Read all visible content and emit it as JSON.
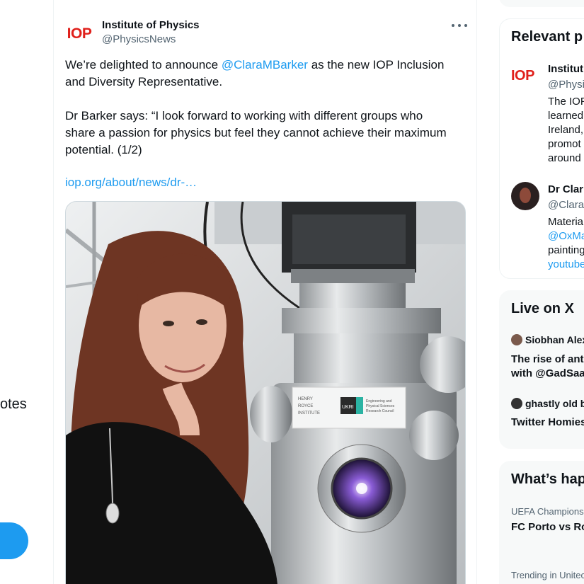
{
  "left_nav": {
    "notes_label": "otes"
  },
  "tweet": {
    "author_name": "Institute of Physics",
    "author_handle": "@PhysicsNews",
    "avatar_logo": "IOP",
    "text_before_mention": "We’re delighted to announce ",
    "mention": "@ClaraMBarker",
    "text_after_mention_line1": " as the new IOP Inclusion",
    "text_line2": "and Diversity Representative.",
    "quote_lines": [
      "Dr Barker says: “I look forward to working with different groups who",
      "share a passion for physics but feel they cannot achieve their maximum",
      "potential. (1/2)"
    ],
    "link": "iop.org/about/news/dr-…",
    "media": {
      "sign_lines": [
        "HENRY",
        "ROYCE",
        "INSTITUTE"
      ],
      "ukri_label": "UKRI",
      "epsrc_lines": [
        "Engineering and",
        "Physical Sciences",
        "Research Council"
      ]
    }
  },
  "relevant_people": {
    "title": "Relevant p",
    "people": [
      {
        "logo": "IOP",
        "name": "Institut",
        "handle": "@Physic",
        "bio_lines": [
          "The IOP",
          "learned",
          "Ireland,",
          "promot",
          "around"
        ]
      },
      {
        "name": "Dr Clar",
        "handle": "@Clara",
        "bio_lines": [
          "Materia",
          "@OxMa",
          "painting",
          "youtube"
        ]
      }
    ]
  },
  "live": {
    "title": "Live on X",
    "items": [
      {
        "host": "Siobhan Alex",
        "title_lines": [
          "The rise of ant",
          "with @GadSaa"
        ]
      },
      {
        "host": "ghastly old b",
        "title_lines": [
          "Twitter Homies"
        ]
      }
    ]
  },
  "whats_happening": {
    "title": "What’s hap",
    "items": [
      {
        "context": "UEFA Champions",
        "headline": "FC Porto vs Ro"
      },
      {
        "context": "Trending in Unitec",
        "headline": ""
      }
    ]
  },
  "colors": {
    "accent": "#1d9bf0",
    "iop_red": "#e0201b",
    "text": "#0f1419",
    "muted": "#536471"
  }
}
